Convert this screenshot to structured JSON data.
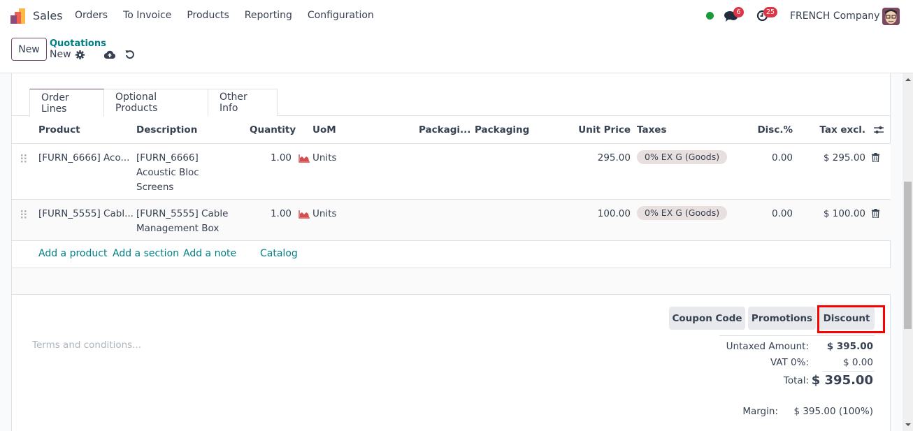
{
  "navbar": {
    "app_name": "Sales",
    "menu": [
      "Orders",
      "To Invoice",
      "Products",
      "Reporting",
      "Configuration"
    ],
    "messages_count": "6",
    "activities_count": "25",
    "company": "FRENCH Company",
    "status_color": "#1a9a3a"
  },
  "control_panel": {
    "new_label": "New",
    "breadcrumb": "Quotations",
    "record_name": "New"
  },
  "tabs": [
    {
      "label": "Order Lines",
      "active": true
    },
    {
      "label": "Optional Products",
      "active": false
    },
    {
      "label": "Other Info",
      "active": false
    }
  ],
  "order_lines": {
    "columns": [
      "Product",
      "Description",
      "Quantity",
      "UoM",
      "Packagi...",
      "Packaging",
      "Unit Price",
      "Taxes",
      "Disc.%",
      "Tax excl."
    ],
    "rows": [
      {
        "product": "[FURN_6666] Aco...",
        "description": "[FURN_6666] Acoustic Bloc Screens",
        "quantity": "1.00",
        "uom": "Units",
        "packaging_qty": "",
        "packaging": "",
        "unit_price": "295.00",
        "taxes": "0% EX G (Goods)",
        "discount": "0.00",
        "subtotal": "$ 295.00"
      },
      {
        "product": "[FURN_5555] Cabl...",
        "description": "[FURN_5555] Cable Management Box",
        "quantity": "1.00",
        "uom": "Units",
        "packaging_qty": "",
        "packaging": "",
        "unit_price": "100.00",
        "taxes": "0% EX G (Goods)",
        "discount": "0.00",
        "subtotal": "$ 100.00"
      }
    ],
    "add_links": [
      "Add a product",
      "Add a section",
      "Add a note",
      "Catalog"
    ]
  },
  "footer": {
    "terms_placeholder": "Terms and conditions...",
    "buttons": [
      "Coupon Code",
      "Promotions",
      "Discount"
    ],
    "highlighted_button": "Discount",
    "highlight_color": "#ff0000",
    "totals": {
      "untaxed_label": "Untaxed Amount:",
      "untaxed_value": "$ 395.00",
      "vat_label": "VAT 0%:",
      "vat_value": "$ 0.00",
      "total_label": "Total:",
      "total_value": "$ 395.00",
      "margin_label": "Margin:",
      "margin_value": "$ 395.00 (100%)"
    }
  },
  "colors": {
    "brand": "#714B67",
    "link": "#017e84",
    "badge": "#dc3545"
  }
}
